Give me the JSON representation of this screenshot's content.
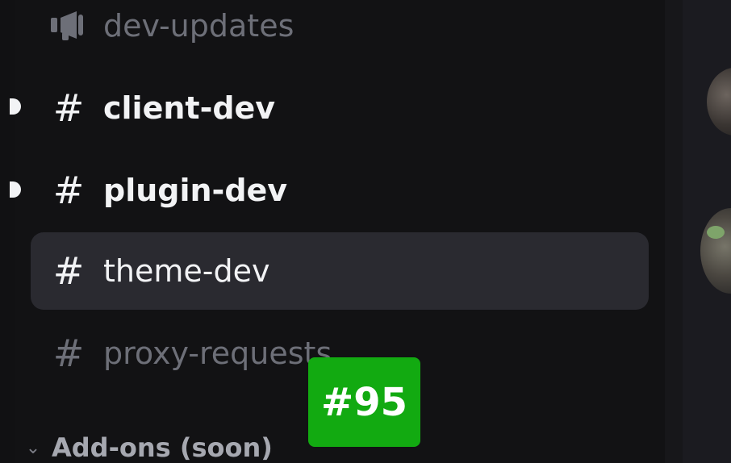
{
  "channels": {
    "dev_updates": {
      "label": "dev-updates",
      "icon": "megaphone-icon"
    },
    "client_dev": {
      "hash": "#",
      "label": "client-dev"
    },
    "plugin_dev": {
      "hash": "#",
      "label": "plugin-dev"
    },
    "theme_dev": {
      "hash": "#",
      "label": "theme-dev"
    },
    "proxy_requests": {
      "hash": "#",
      "label": "proxy-requests"
    }
  },
  "category": {
    "chevron": "⌄",
    "label": "Add-ons (soon)"
  },
  "overlay_badge": {
    "text": "#95",
    "color": "#12aa11"
  },
  "colors": {
    "sidebar_bg": "#121214",
    "selected_bg": "#2a2a30",
    "muted_text": "#6d6f78",
    "bright_text": "#f2f3f5"
  }
}
